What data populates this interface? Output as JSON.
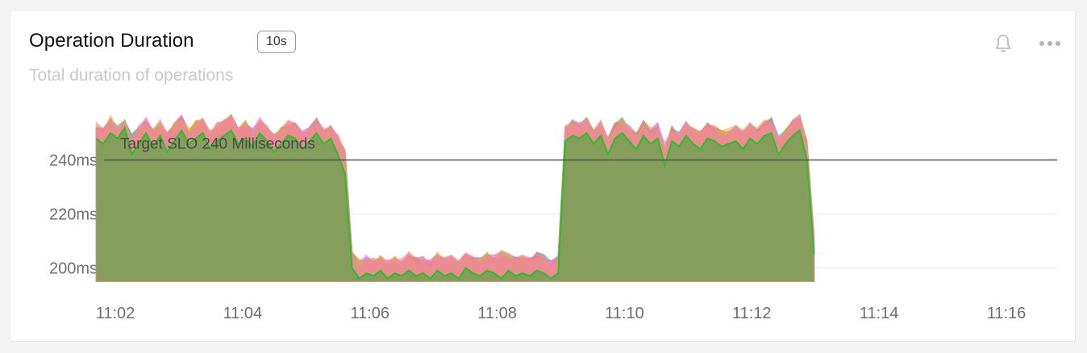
{
  "panel": {
    "title": "Operation Duration",
    "interval_badge": "10s",
    "subtitle": "Total duration of operations"
  },
  "icons": {
    "alert": "bell-icon",
    "menu": "more-horizontal-icon"
  },
  "colors": {
    "main_series": "#2bbd2b",
    "main_fill": "#7f9f5a",
    "threshold": "#555555",
    "series": [
      "#e6a817",
      "#e94b8a",
      "#2ba8e0",
      "#f07aa0",
      "#c8a0e8",
      "#e58c3a",
      "#d4b94a",
      "#ff7ab8"
    ]
  },
  "chart_data": {
    "type": "area",
    "title": "Operation Duration",
    "xlabel": "",
    "ylabel": "",
    "x_ticks": [
      "11:02",
      "11:04",
      "11:06",
      "11:08",
      "11:10",
      "11:12",
      "11:14",
      "11:16"
    ],
    "y_ticks": [
      "200ms",
      "220ms",
      "240ms"
    ],
    "ylim": [
      195,
      262
    ],
    "grid": true,
    "threshold": {
      "value": 240,
      "label": "Target SLO 240 Milliseconds"
    },
    "x_range": [
      "11:01.7",
      "11:16.8"
    ],
    "series": [
      {
        "role": "main",
        "x_start": "11:01.7",
        "x_step_seconds": 6.7,
        "values": [
          248,
          246,
          250,
          248,
          252,
          242,
          246,
          250,
          245,
          249,
          243,
          247,
          251,
          246,
          248,
          250,
          244,
          247,
          249,
          251,
          246,
          248,
          245,
          250,
          247,
          243,
          246,
          249,
          248,
          244,
          247,
          250,
          246,
          248,
          242,
          235,
          200,
          196,
          198,
          197,
          199,
          196,
          198,
          197,
          199,
          197,
          198,
          196,
          199,
          197,
          198,
          196,
          200,
          198,
          197,
          199,
          198,
          196,
          199,
          197,
          198,
          197,
          199,
          198,
          196,
          198,
          247,
          249,
          248,
          250,
          246,
          249,
          242,
          248,
          250,
          247,
          244,
          249,
          246,
          248,
          238,
          247,
          245,
          249,
          246,
          244,
          248,
          247,
          245,
          246,
          247,
          244,
          248,
          246,
          249,
          250,
          242,
          246,
          249,
          251,
          240,
          205
        ],
        "envelope_high": [
          254,
          252,
          257,
          253,
          255,
          250,
          253,
          256,
          252,
          255,
          251,
          254,
          257,
          252,
          255,
          256,
          251,
          254,
          255,
          257,
          252,
          255,
          252,
          256,
          253,
          250,
          252,
          255,
          254,
          251,
          253,
          256,
          252,
          254,
          250,
          245,
          206,
          203,
          205,
          204,
          205,
          203,
          205,
          204,
          206,
          204,
          205,
          203,
          206,
          204,
          205,
          203,
          206,
          205,
          204,
          206,
          205,
          208,
          206,
          204,
          205,
          204,
          206,
          205,
          203,
          205,
          253,
          255,
          254,
          256,
          252,
          255,
          249,
          254,
          256,
          253,
          251,
          255,
          252,
          254,
          247,
          253,
          251,
          255,
          252,
          251,
          254,
          253,
          251,
          252,
          253,
          251,
          254,
          252,
          255,
          256,
          249,
          252,
          255,
          257,
          248,
          214
        ]
      }
    ]
  }
}
